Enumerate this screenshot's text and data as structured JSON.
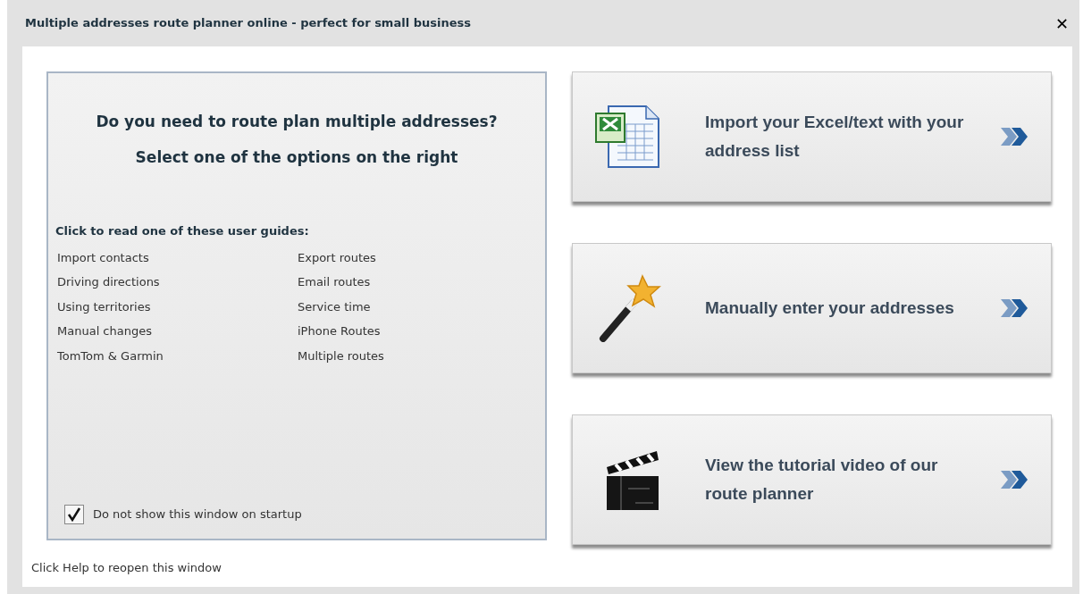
{
  "window": {
    "title": "Multiple addresses route planner online - perfect for small business",
    "close": "✕"
  },
  "intro": {
    "question": "Do you need to route plan multiple addresses?",
    "instruction": "Select one of the options on the right"
  },
  "guides": {
    "heading": "Click to read one of these user guides:",
    "columns": [
      [
        "Import contacts",
        "Driving directions",
        "Using territories",
        "Manual changes",
        "TomTom & Garmin"
      ],
      [
        "Export routes",
        "Email routes",
        "Service time",
        "iPhone Routes",
        "Multiple routes"
      ]
    ]
  },
  "startup_option": {
    "label": "Do not show this window on startup",
    "checked": true
  },
  "options": [
    {
      "kind": "spreadsheet",
      "label": "Import your Excel/text with your address list"
    },
    {
      "kind": "wand",
      "label": "Manually enter your addresses"
    },
    {
      "kind": "clapper",
      "label": "View the tutorial video of our route planner"
    }
  ],
  "footer": "Click Help to reopen this window"
}
